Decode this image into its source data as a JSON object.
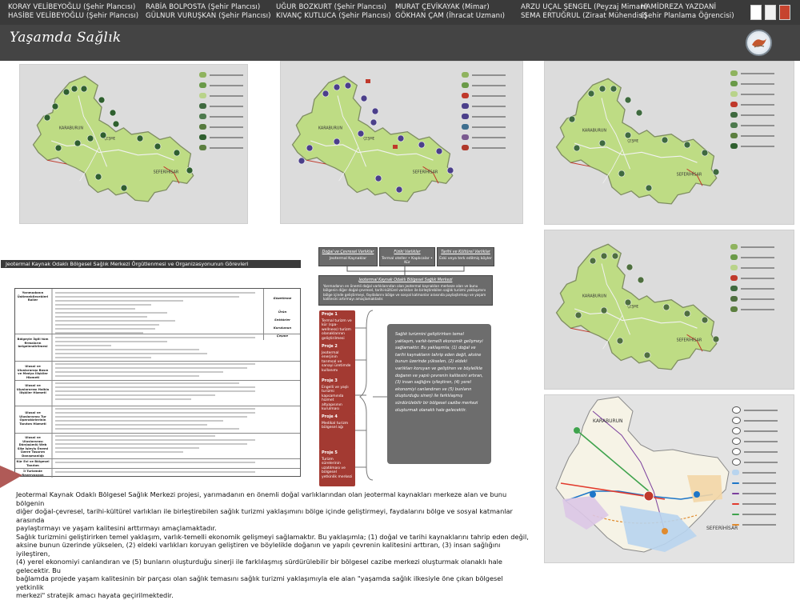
{
  "header": {
    "credits": [
      {
        "name": "KORAY VELİBEYOĞLU (Şehir Plancısı)"
      },
      {
        "name": "HASİBE VELİBEYOĞLU (Şehir Plancısı)"
      },
      {
        "name": "RABİA BOLPOSTA (Şehir Plancısı)"
      },
      {
        "name": "GÜLNUR VURUŞKAN (Şehir Plancısı)"
      },
      {
        "name": "UĞUR BOZKURT (Şehir Plancısı)"
      },
      {
        "name": "KIVANÇ KUTLUCA (Şehir Plancısı)"
      },
      {
        "name": "MURAT ÇEVİKAYAK (Mimar)"
      },
      {
        "name": "GÖKHAN ÇAM (İhracat Uzmanı)"
      },
      {
        "name": "ARZU UÇAL ŞENGEL (Peyzaj Mimarı)"
      },
      {
        "name": "SEMA ERTUĞRUL (Ziraat Mühendisi)"
      },
      {
        "name": "HAMİDREZA YAZDANİ"
      },
      {
        "name": "(Şehir Planlama Öğrencisi)"
      }
    ]
  },
  "title": "Yaşamda Sağlık",
  "colors": {
    "topbar": "#3a3a3a",
    "titlebar": "#444444",
    "map_land": "#bedc84",
    "map_sea": "#d9d9d9",
    "proje_box": "#a33a32",
    "text_box": "#6d6d6d",
    "accent_wedge": "#b05a57"
  },
  "section_title": "Jeotermal Kaynak Odaklı Bölgesel Sağlık Merkezi Örgütlenmesi ve Organizasyonunun Görevleri",
  "diagram": {
    "top_boxes": [
      {
        "title": "Doğal ve Çevresel Varlıklar",
        "sub": "Jeotermal Kaynaklar"
      },
      {
        "title": "Fiziki Varlıklar",
        "sub": "Termal oteller • Kaplıcalar • Kür"
      },
      {
        "title": "Tarihi ve Kültürel Varlıklar",
        "sub": "Eski veya terk edilmiş köyler"
      }
    ],
    "center_title": "Jeotermal Kaynak Odaklı Bölgesel Sağlık Merkezi",
    "center_text": "Yarımadanın en önemli doğal varlıklarından olan jeotermal kaynakları merkeze alan ve bunu bölgenin diğer doğal-çevresel, tarihi-kültürel varlıkları ile birleştirebilen sağlık turizmi yaklaşımını bölge içinde geliştirmeyi, faydalarını bölge ve sosyal katmanlar arasında paylaştırmayı ve yaşam kalitesini artırmayı amaçlamaktadır.",
    "projects": [
      {
        "label": "Proje 1",
        "text": "Termal turizm ve kür (spa-wellness) turizm olanaklarının geliştirilmesi"
      },
      {
        "label": "Proje 2",
        "text": "Jeotermal enerjinin tarımsal ve sanayi üretimde kullanımı"
      },
      {
        "label": "Proje 3",
        "text": "Engelli ve yaşlı turizmi kapsamında hizmet altyapısının kurulması"
      },
      {
        "label": "Proje 4",
        "text": "Medikal turizm bölgesel ağı"
      },
      {
        "label": "Proje 5",
        "text": "Turizm sürelerinin uzatılması ve bölgesel yetkinlik merkezi"
      }
    ],
    "right_text": "Sağlık turizmini geliştirirken temel yaklaşım, varlık-temelli ekonomik gelişmeyi sağlamaktır. Bu yaklaşımla; (1) doğal ve tarihi kaynakların tahrip eden değil, aksine bunun üzerinde yükselen, (2) eldeki varlıkları koruyan ve geliştiren ve böylelikle doğanın ve yapılı çevrenin kalitesini artıran, (3) insan sağlığını iyileştiren, (4) yerel ekonomiyi canlandıran ve (5) bunların oluşturduğu sinerji ile farklılaşmış sürdürülebilir bir bölgesel cazibe merkezi oluşturmak olanaklı hale gelecektir."
  },
  "table": {
    "row_labels": [
      "Yarımadanın Üstlenebilecekleri Roller",
      "Bölgeyle İlgili tüm firmaların belgelendirilmesi",
      "Ulusal ve Uluslararası Basın ve Medya İlişkiler Hizmeti",
      "Ulusal ve Uluslararası Halkla İlişkiler Hizmeti",
      "Ulusal ve Uluslararası Tur Operatörlerinin Tanıtım Hizmeti",
      "Ulusal ve Uluslararası Dönüşümlü Web Site İşleyiş Önemi Üzere Tasarım Danışmanlığı",
      "Kür Evi ve Bölgesel Tanıtım",
      "İl Turizmde Rezervasyon"
    ],
    "side_labels": [
      "Gözetleme",
      "Ürün",
      "Sektörler",
      "Kurulunun",
      "Çeşme"
    ]
  },
  "body_paragraph": [
    "Jeotermal Kaynak Odaklı Bölgesel Sağlık Merkezi projesi, yarımadanın en önemli doğal varlıklarından olan jeotermal kaynakları merkeze alan ve bunu bölgenin",
    "diğer doğal-çevresel, tarihi-kültürel varlıkları ile birleştirebilen sağlık turizmi yaklaşımını bölge içinde geliştirmeyi, faydalarını bölge ve sosyal katmanlar arasında",
    "paylaştırmayı ve yaşam kalitesini arttırmayı amaçlamaktadır.",
    "Sağlık turizmini geliştirirken temel yaklaşım, varlık-temelli ekonomik gelişmeyi sağlamaktır. Bu yaklaşımla; (1) doğal ve tarihi kaynaklarını tahrip eden değil,",
    "aksine bunun üzerinde yükselen, (2) eldeki varlıkları koruyan geliştiren ve böylelikle doğanın ve yapılı çevrenin kalitesini arttıran, (3) insan sağlığını iyileştiren,",
    "(4) yerel ekonomiyi canlandıran ve (5) bunların oluşturduğu sinerji ile farklılaşmış sürdürülebilir bir bölgesel cazibe merkezi oluşturmak olanaklı hale gelecektir. Bu",
    "bağlamda projede yaşam kalitesinin bir parçası olan sağlık temasını sağlık turizmi yaklaşımıyla ele alan \"yaşamda sağlık ilkesiyle öne çıkan bölgesel yetkinlik",
    "merkezi\" stratejik amacı hayata geçirilmektedir."
  ]
}
